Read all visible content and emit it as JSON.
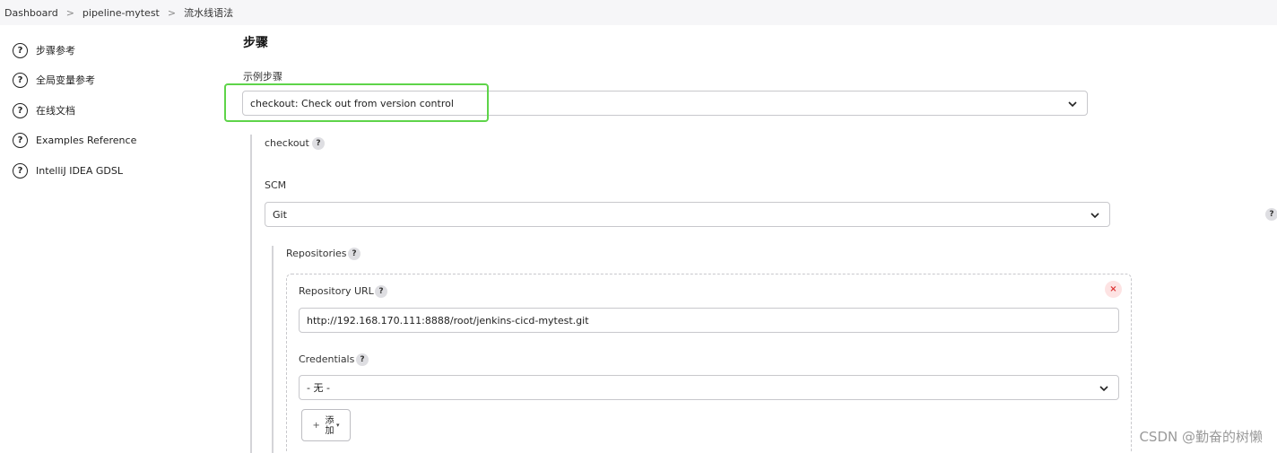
{
  "breadcrumb": {
    "items": [
      "Dashboard",
      "pipeline-mytest",
      "流水线语法"
    ],
    "separator": ">"
  },
  "sidebar": {
    "items": [
      {
        "label": "步骤参考",
        "icon": "help-circle-icon"
      },
      {
        "label": "全局变量参考",
        "icon": "help-circle-icon"
      },
      {
        "label": "在线文档",
        "icon": "help-circle-icon"
      },
      {
        "label": "Examples Reference",
        "icon": "help-circle-icon"
      },
      {
        "label": "IntelliJ IDEA GDSL",
        "icon": "help-circle-icon"
      }
    ]
  },
  "main": {
    "title": "步骤",
    "sample_step": {
      "label": "示例步骤",
      "value": "checkout: Check out from version control"
    },
    "checkout_label": "checkout",
    "scm": {
      "label": "SCM",
      "value": "Git"
    },
    "repositories": {
      "label": "Repositories",
      "url_label": "Repository URL",
      "url_value": "http://192.168.170.111:8888/root/jenkins-cicd-mytest.git",
      "credentials_label": "Credentials",
      "credentials_value": "- 无 -",
      "add_button": {
        "plus": "+",
        "label": "添加"
      },
      "remove_glyph": "×"
    },
    "help_glyph": "?"
  },
  "watermark": "CSDN @勤奋的树懒",
  "colors": {
    "highlight": "#5ed449",
    "remove": "#d33333",
    "breadcrumb_bg": "#f6f6f8"
  }
}
